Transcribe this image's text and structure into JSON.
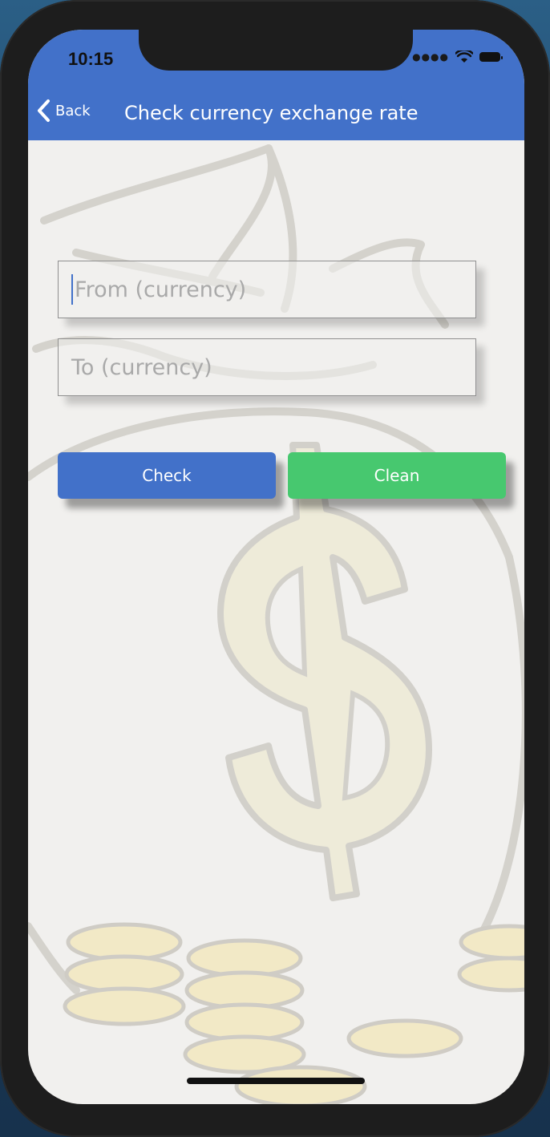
{
  "status_bar": {
    "time": "10:15"
  },
  "nav": {
    "back_label": "Back",
    "title": "Check currency exchange rate"
  },
  "form": {
    "from_placeholder": "From (currency)",
    "to_placeholder": "To (currency)"
  },
  "actions": {
    "check_label": "Check",
    "clean_label": "Clean"
  },
  "colors": {
    "nav_bar": "#4271c9",
    "check_button": "#4271c9",
    "clean_button": "#47c86f",
    "screen_background": "#f1f0ee"
  },
  "icons": {
    "back": "chevron-left-icon",
    "wifi": "wifi-icon",
    "battery": "battery-icon",
    "signal": "signal-icon",
    "background": "money-bag-illustration"
  }
}
